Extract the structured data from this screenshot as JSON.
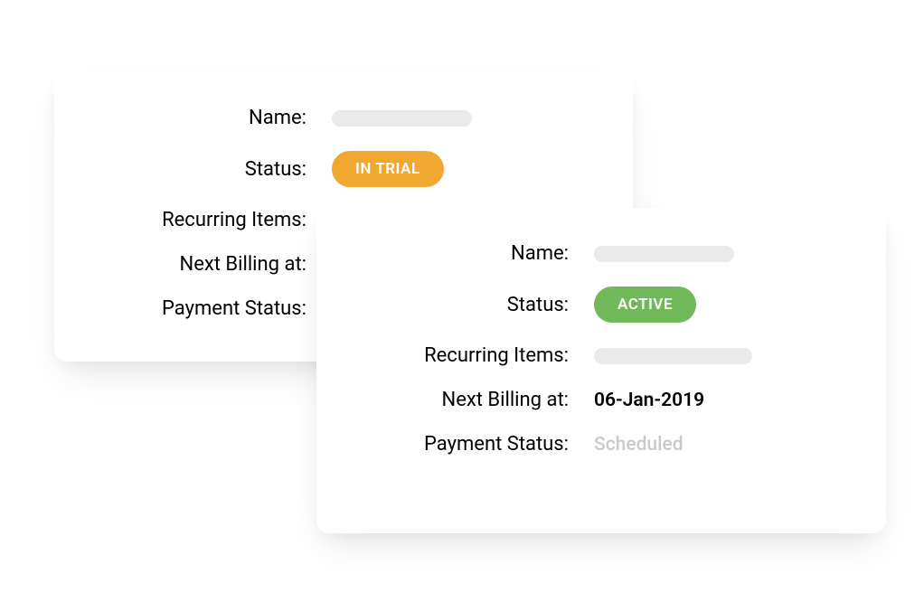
{
  "labels": {
    "name": "Name:",
    "status": "Status:",
    "recurring": "Recurring Items:",
    "next_billing": "Next Billing at:",
    "payment_status": "Payment Status:"
  },
  "card_back": {
    "status_badge": "IN TRIAL"
  },
  "card_front": {
    "status_badge": "ACTIVE",
    "next_billing_value": "06-Jan-2019",
    "payment_status_value": "Scheduled"
  },
  "colors": {
    "trial_badge": "#f0a831",
    "active_badge": "#71b858",
    "placeholder": "#eaeaea",
    "muted_text": "#c9c9c9"
  }
}
